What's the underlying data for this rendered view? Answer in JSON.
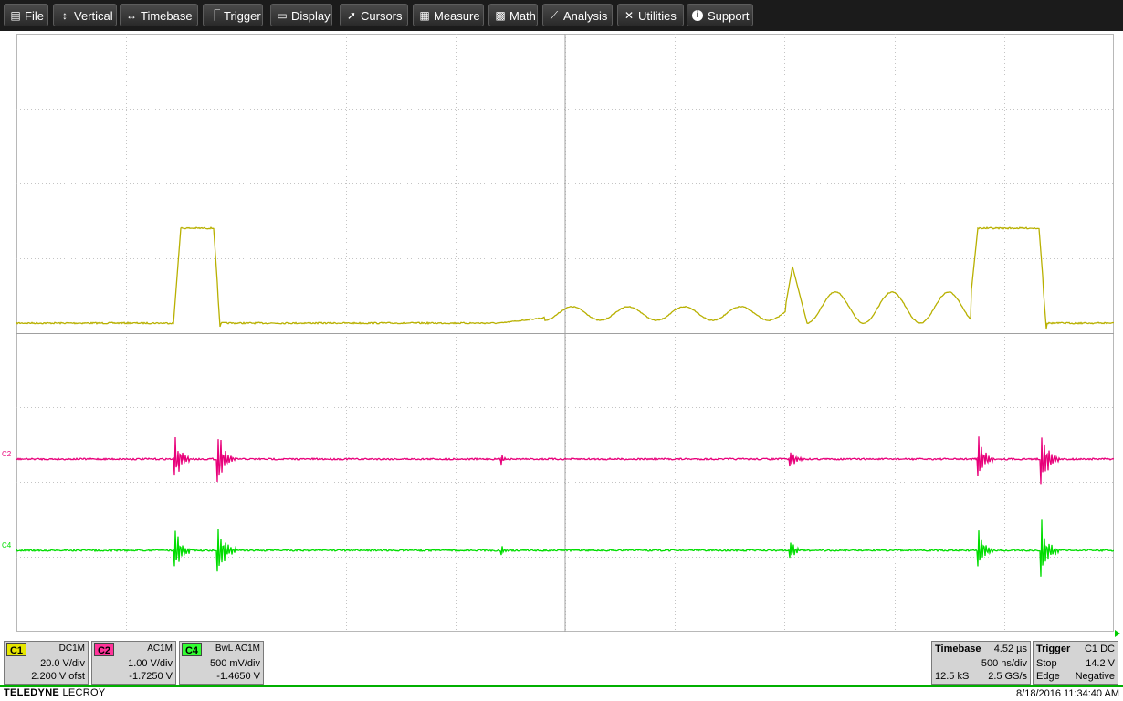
{
  "menu": [
    {
      "label": "File",
      "icon": "file-icon"
    },
    {
      "label": "Vertical",
      "icon": "vertical-arrows-icon"
    },
    {
      "label": "Timebase",
      "icon": "horizontal-arrows-icon"
    },
    {
      "label": "Trigger",
      "icon": "trigger-icon"
    },
    {
      "label": "Display",
      "icon": "display-icon"
    },
    {
      "label": "Cursors",
      "icon": "cursor-icon"
    },
    {
      "label": "Measure",
      "icon": "measure-icon"
    },
    {
      "label": "Math",
      "icon": "math-icon"
    },
    {
      "label": "Analysis",
      "icon": "analysis-icon"
    },
    {
      "label": "Utilities",
      "icon": "utilities-icon"
    },
    {
      "label": "Support",
      "icon": "support-icon"
    }
  ],
  "traces": {
    "c2_label": "C2",
    "c4_label": "C4",
    "c1_color": "#b8b000",
    "c2_color": "#e8007a",
    "c4_color": "#00dd00"
  },
  "channels": [
    {
      "tag": "C1",
      "coupling": "DC1M",
      "scale": "20.0 V/div",
      "offset": "2.200 V ofst",
      "color": "#e6e600"
    },
    {
      "tag": "C2",
      "coupling": "AC1M",
      "scale": "1.00 V/div",
      "offset": "-1.7250 V",
      "color": "#ff3399"
    },
    {
      "tag": "C4",
      "coupling": "BwL AC1M",
      "scale": "500 mV/div",
      "offset": "-1.4650 V",
      "color": "#33ff33"
    }
  ],
  "timebase": {
    "title": "Timebase",
    "delay": "4.52 µs",
    "per_div": "500 ns/div",
    "samples": "12.5 kS",
    "rate": "2.5 GS/s"
  },
  "trigger": {
    "title": "Trigger",
    "source": "C1 DC",
    "mode": "Stop",
    "level": "14.2 V",
    "type": "Edge",
    "slope": "Negative"
  },
  "footer": {
    "brand_bold": "TELEDYNE",
    "brand_rest": "LECROY",
    "datetime": "8/18/2016 11:34:40 AM"
  }
}
